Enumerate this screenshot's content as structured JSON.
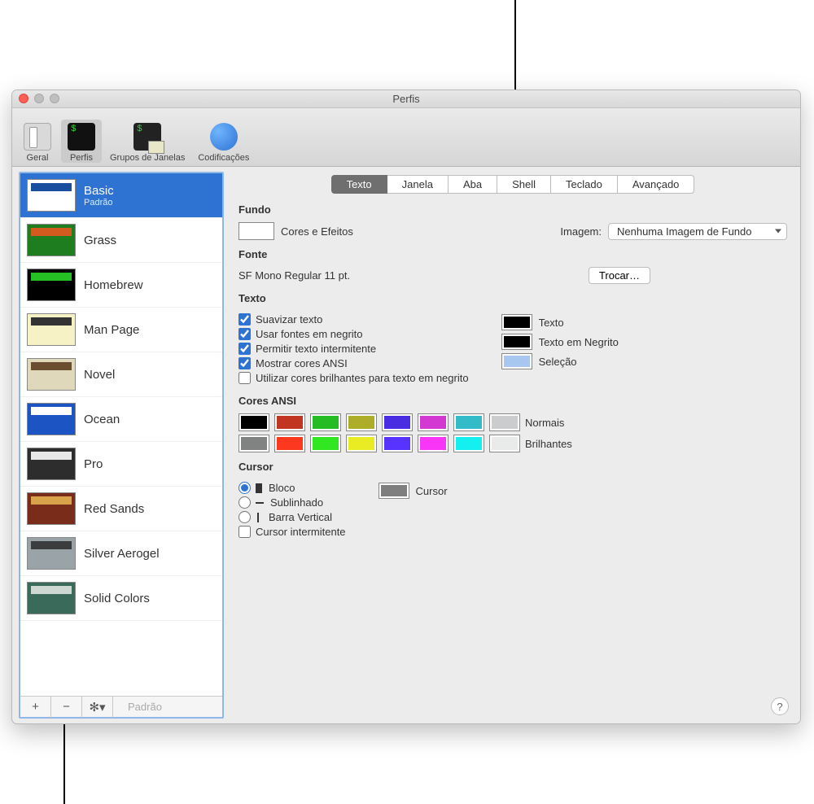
{
  "window_title": "Perfis",
  "toolbar": {
    "items": [
      {
        "label": "Geral"
      },
      {
        "label": "Perfis"
      },
      {
        "label": "Grupos de Janelas"
      },
      {
        "label": "Codificações"
      }
    ]
  },
  "sidebar": {
    "profiles": [
      {
        "name": "Basic",
        "subtitle": "Padrão",
        "bg": "#ffffff",
        "fg": "#1a4fa0"
      },
      {
        "name": "Grass",
        "bg": "#1e7d1e",
        "fg": "#d35b1f"
      },
      {
        "name": "Homebrew",
        "bg": "#000000",
        "fg": "#24c024"
      },
      {
        "name": "Man Page",
        "bg": "#f7f2c6",
        "fg": "#333333"
      },
      {
        "name": "Novel",
        "bg": "#e0d8bb",
        "fg": "#6b4e2f"
      },
      {
        "name": "Ocean",
        "bg": "#1d54c4",
        "fg": "#ffffff"
      },
      {
        "name": "Pro",
        "bg": "#2d2d2d",
        "fg": "#e8e8e8"
      },
      {
        "name": "Red Sands",
        "bg": "#7a2c1a",
        "fg": "#d8a34a"
      },
      {
        "name": "Silver Aerogel",
        "bg": "#9aa3a8",
        "fg": "#3a3c3d"
      },
      {
        "name": "Solid Colors",
        "bg": "#3a6a5a",
        "fg": "#cdd8d2"
      }
    ],
    "footer_default": "Padrão"
  },
  "tabs": [
    {
      "label": "Texto"
    },
    {
      "label": "Janela"
    },
    {
      "label": "Aba"
    },
    {
      "label": "Shell"
    },
    {
      "label": "Teclado"
    },
    {
      "label": "Avançado"
    }
  ],
  "background": {
    "title": "Fundo",
    "colors_effects": "Cores e Efeitos",
    "image_label": "Imagem:",
    "image_select": "Nenhuma Imagem de Fundo",
    "well_color": "#ffffff"
  },
  "font": {
    "title": "Fonte",
    "current": "SF Mono Regular 11 pt.",
    "change_btn": "Trocar…"
  },
  "text": {
    "title": "Texto",
    "smooth": "Suavizar texto",
    "bold_fonts": "Usar fontes em negrito",
    "blink": "Permitir texto intermitente",
    "ansi_colors": "Mostrar cores ANSI",
    "bright_bold": "Utilizar cores brilhantes para texto em negrito",
    "text_label": "Texto",
    "bold_label": "Texto em Negrito",
    "selection_label": "Seleção",
    "text_color": "#000000",
    "bold_color": "#000000",
    "selection_color": "#a8c7f0"
  },
  "ansi": {
    "title": "Cores ANSI",
    "normal_label": "Normais",
    "bright_label": "Brilhantes",
    "normal": [
      "#000000",
      "#c23621",
      "#25bc24",
      "#adad27",
      "#492ee1",
      "#d338d3",
      "#33bbc8",
      "#cbcccd"
    ],
    "bright": [
      "#818383",
      "#fc391f",
      "#31e722",
      "#eaec23",
      "#5833ff",
      "#f935f8",
      "#14f0f0",
      "#e9ebeb"
    ]
  },
  "cursor": {
    "title": "Cursor",
    "block": "Bloco",
    "underline": "Sublinhado",
    "vbar": "Barra Vertical",
    "blink": "Cursor intermitente",
    "color_label": "Cursor",
    "color": "#7f7f7f"
  }
}
